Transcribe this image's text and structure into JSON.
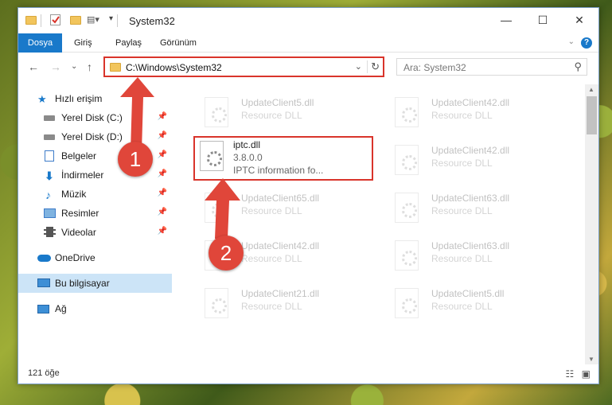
{
  "window": {
    "title": "System32",
    "minimize": "—",
    "maximize": "☐",
    "close": "✕"
  },
  "ribbon": {
    "tabs": [
      "Dosya",
      "Giriş",
      "Paylaş",
      "Görünüm"
    ],
    "help": "?"
  },
  "nav": {
    "back": "←",
    "forward": "→",
    "recent": "⌄",
    "up": "↑",
    "address": "C:\\Windows\\System32",
    "search_placeholder": "Ara: System32"
  },
  "sidebar": {
    "items": [
      {
        "label": "Hızlı erişim",
        "icon": "star-icon"
      },
      {
        "label": "Yerel Disk (C:)",
        "icon": "drive-icon"
      },
      {
        "label": "Yerel Disk (D:)",
        "icon": "drive-icon"
      },
      {
        "label": "Belgeler",
        "icon": "documents-icon"
      },
      {
        "label": "İndirmeler",
        "icon": "download-icon"
      },
      {
        "label": "Müzik",
        "icon": "music-icon"
      },
      {
        "label": "Resimler",
        "icon": "pictures-icon"
      },
      {
        "label": "Videolar",
        "icon": "video-icon"
      },
      {
        "label": "OneDrive",
        "icon": "cloud-icon"
      },
      {
        "label": "Bu bilgisayar",
        "icon": "computer-icon"
      },
      {
        "label": "Ağ",
        "icon": "network-icon"
      }
    ]
  },
  "files": {
    "left": [
      {
        "name": "UpdateClient5.dll",
        "desc": "Resource DLL"
      },
      {
        "name": "iptc.dll",
        "version": "3.8.0.0",
        "desc": "IPTC information fo..."
      },
      {
        "name": "UpdateClient65.dll",
        "desc": "Resource DLL"
      },
      {
        "name": "UpdateClient42.dll",
        "desc": "Resource DLL"
      },
      {
        "name": "UpdateClient21.dll",
        "desc": "Resource DLL"
      }
    ],
    "right": [
      {
        "name": "UpdateClient42.dll",
        "desc": "Resource DLL"
      },
      {
        "name": "UpdateClient42.dll",
        "desc": "Resource DLL"
      },
      {
        "name": "UpdateClient63.dll",
        "desc": "Resource DLL"
      },
      {
        "name": "UpdateClient63.dll",
        "desc": "Resource DLL"
      },
      {
        "name": "UpdateClient5.dll",
        "desc": "Resource DLL"
      }
    ]
  },
  "status": {
    "count": "121 öğe"
  },
  "annotations": {
    "badge1": "1",
    "badge2": "2",
    "color": "#e0463a"
  }
}
